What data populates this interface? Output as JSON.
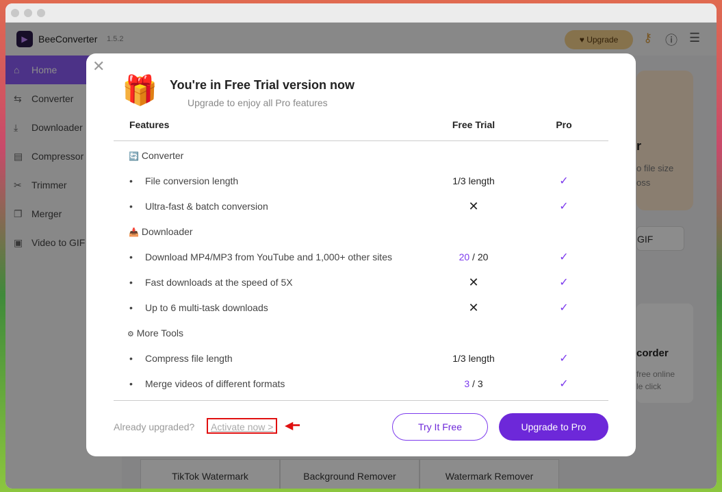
{
  "app": {
    "name": "BeeConverter",
    "version": "1.5.2",
    "upgrade_label": "Upgrade"
  },
  "sidebar": {
    "items": [
      {
        "label": "Home",
        "icon": "home-icon"
      },
      {
        "label": "Converter",
        "icon": "convert-icon"
      },
      {
        "label": "Downloader",
        "icon": "download-icon"
      },
      {
        "label": "Compressor",
        "icon": "compress-icon"
      },
      {
        "label": "Trimmer",
        "icon": "scissors-icon"
      },
      {
        "label": "Merger",
        "icon": "merge-icon"
      },
      {
        "label": "Video to GIF",
        "icon": "gif-icon"
      }
    ]
  },
  "background": {
    "card1_title": "r",
    "card1_text1": "o file size",
    "card1_text2": "oss",
    "gif_button": "GIF",
    "card2_title": "corder",
    "card2_text1": "free online",
    "card2_text2": "le click",
    "tabs": [
      "TikTok Watermark",
      "Background Remover",
      "Watermark Remover"
    ]
  },
  "modal": {
    "title": "You're in Free Trial version now",
    "subtitle": "Upgrade to enjoy all Pro features",
    "headers": {
      "features": "Features",
      "free": "Free Trial",
      "pro": "Pro"
    },
    "sections": [
      {
        "name": "Converter",
        "icon": "🔄",
        "rows": [
          {
            "feature": "File conversion length",
            "free": "1/3 length",
            "pro": "✓"
          },
          {
            "feature": "Ultra-fast & batch conversion",
            "free": "✕",
            "pro": "✓"
          }
        ]
      },
      {
        "name": "Downloader",
        "icon": "📥",
        "rows": [
          {
            "feature": "Download MP4/MP3 from YouTube and 1,000+ other sites",
            "free_used": "20",
            "free_sep": " / ",
            "free_total": "20",
            "pro": "✓"
          },
          {
            "feature": "Fast downloads at the speed of 5X",
            "free": "✕",
            "pro": "✓"
          },
          {
            "feature": "Up to 6 multi-task downloads",
            "free": "✕",
            "pro": "✓"
          }
        ]
      },
      {
        "name": "More Tools",
        "icon": "⚙",
        "rows": [
          {
            "feature": "Compress file length",
            "free": "1/3 length",
            "pro": "✓"
          },
          {
            "feature": "Merge videos of different formats",
            "free_used": "3",
            "free_sep": " / ",
            "free_total": "3",
            "pro": "✓"
          }
        ]
      }
    ],
    "already": "Already upgraded?",
    "activate": "Activate now >",
    "try_label": "Try It Free",
    "pro_label": "Upgrade to Pro"
  }
}
